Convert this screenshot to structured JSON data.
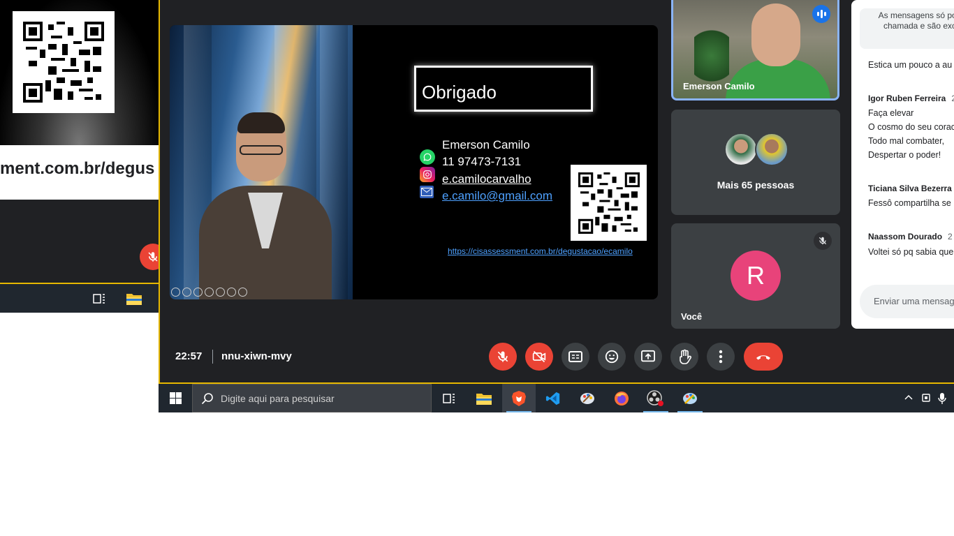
{
  "left_preview": {
    "url_text": "ment.com.br/degus"
  },
  "slide": {
    "title": "Obrigado",
    "contact_name": "Emerson Camilo",
    "phone": "11 97473-7131",
    "instagram": "e.camilocarvalho",
    "email": "e.camilo@gmail.com",
    "url": "https://cisassessment.com.br/degustacao/ecamilo"
  },
  "participants": {
    "speaker_name": "Emerson Camilo",
    "group_label": "Mais 65 pessoas",
    "self_initial": "R",
    "self_name": "Você"
  },
  "chat": {
    "notice": "As mensagens só pod chamada e são exc",
    "messages": [
      {
        "sender": "",
        "time": "",
        "lines": [
          "Estica um pouco a au"
        ]
      },
      {
        "sender": "Igor Ruben Ferreira",
        "time": "2",
        "lines": [
          "Faça elevar",
          "O cosmo do seu corac",
          "Todo mal combater,",
          "Despertar o poder!"
        ]
      },
      {
        "sender": "Ticiana Silva Bezerra",
        "time": "",
        "lines": [
          "Fessô compartilha se"
        ]
      },
      {
        "sender": "Naassom Dourado",
        "time": "2",
        "lines": [
          "Voltei só pq sabia que"
        ]
      }
    ],
    "input_placeholder": "Enviar uma mensage"
  },
  "meeting": {
    "time": "22:57",
    "code": "nnu-xiwn-mvy"
  },
  "taskbar": {
    "search_placeholder": "Digite aqui para pesquisar"
  },
  "colors": {
    "meet_bg": "#202124",
    "tile_bg": "#3c4043",
    "danger": "#ea4335",
    "speaker_border": "#8ab4f8",
    "self_avatar": "#e8437a",
    "window_border": "#e6b800",
    "taskbar_bg": "#20272f"
  }
}
